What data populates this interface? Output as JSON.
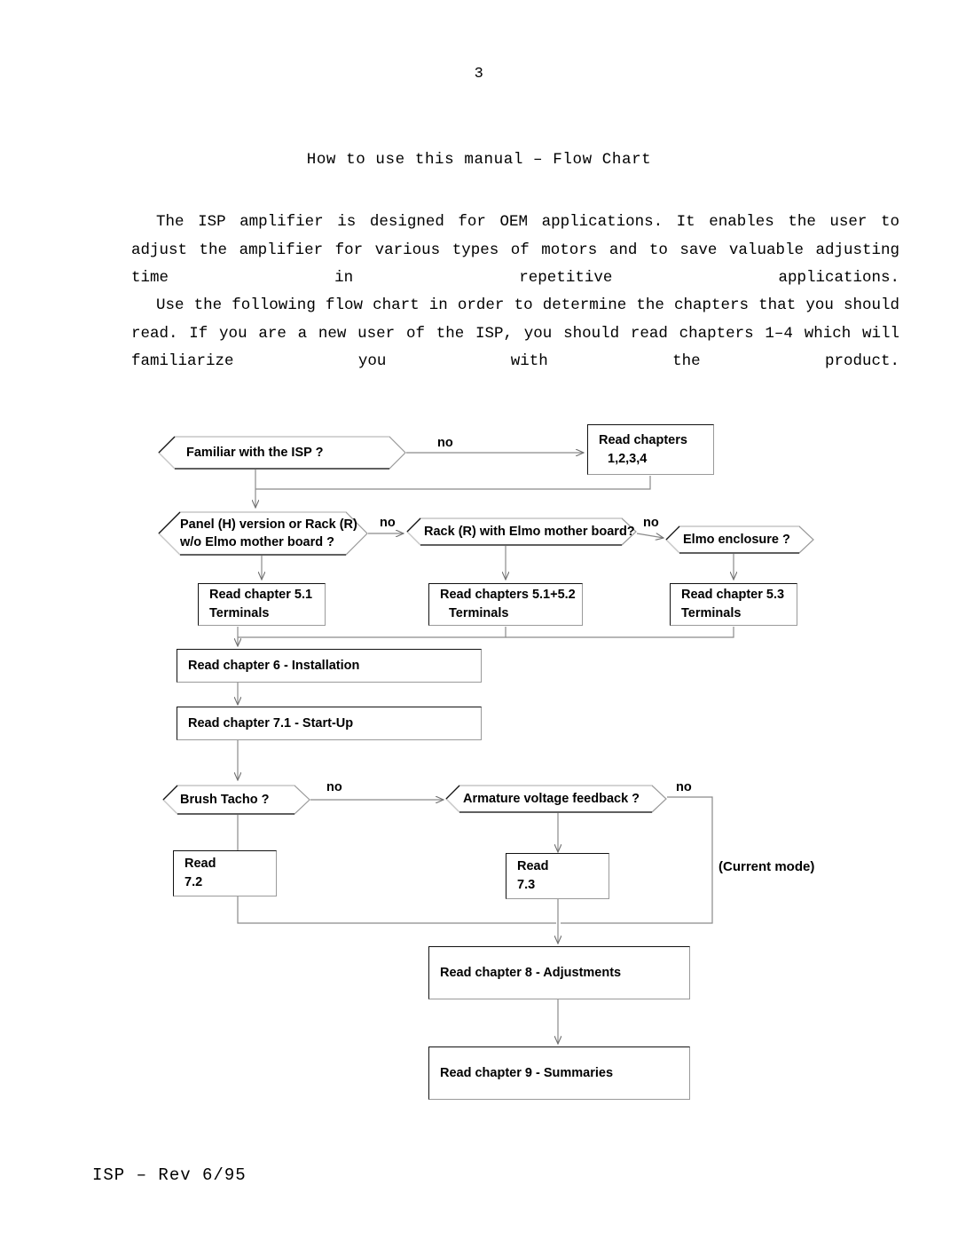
{
  "page": {
    "number": "3",
    "title": "How to use this manual – Flow Chart",
    "footer": "ISP – Rev 6/95"
  },
  "body": {
    "paragraph1": "The ISP amplifier is designed for OEM applications. It enables the user to adjust the amplifier for various types of motors and to save valuable adjusting time in repetitive applications.",
    "paragraph2": "Use the following flow chart in order to determine the chapters that you should read. If you are a new user of the ISP, you should read chapters 1–4 which will familiarize you with the product."
  },
  "flowchart": {
    "nodes": {
      "familiar_isp": "Familiar with the ISP ?",
      "read_chapters_1234_l1": "Read chapters",
      "read_chapters_1234_l2": "1,2,3,4",
      "panel_rack_l1": "Panel (H) version or Rack (R)",
      "panel_rack_l2": "w/o Elmo mother board ?",
      "rack_mother_board": "Rack (R) with Elmo mother board?",
      "elmo_enclosure": "Elmo enclosure ?",
      "chapter_51_l1": "Read chapter 5.1",
      "chapter_51_l2": "Terminals",
      "chapter_51_52_l1": "Read chapters 5.1+5.2",
      "chapter_51_52_l2": "Terminals",
      "chapter_53_l1": "Read chapter 5.3",
      "chapter_53_l2": "Terminals",
      "chapter_6": "Read chapter 6 - Installation",
      "chapter_71": "Read chapter 7.1 - Start-Up",
      "brush_tacho": "Brush Tacho ?",
      "armature_feedback": "Armature voltage feedback  ?",
      "read_72_l1": "Read",
      "read_72_l2": "7.2",
      "read_73_l1": "Read",
      "read_73_l2": "7.3",
      "chapter_8": "Read chapter 8 - Adjustments",
      "chapter_9": "Read chapter 9 - Summaries"
    },
    "edge_labels": {
      "no_familiar": "no",
      "no_panel": "no",
      "no_rack": "no",
      "no_brush": "no",
      "no_armature": "no"
    },
    "annotations": {
      "current_mode": "(Current mode)"
    }
  },
  "colors": {
    "line": "#8a8a8a",
    "shape_border_dark": "#111111",
    "shape_border_light": "#9a9a9a",
    "text": "#000000",
    "background": "#ffffff"
  }
}
